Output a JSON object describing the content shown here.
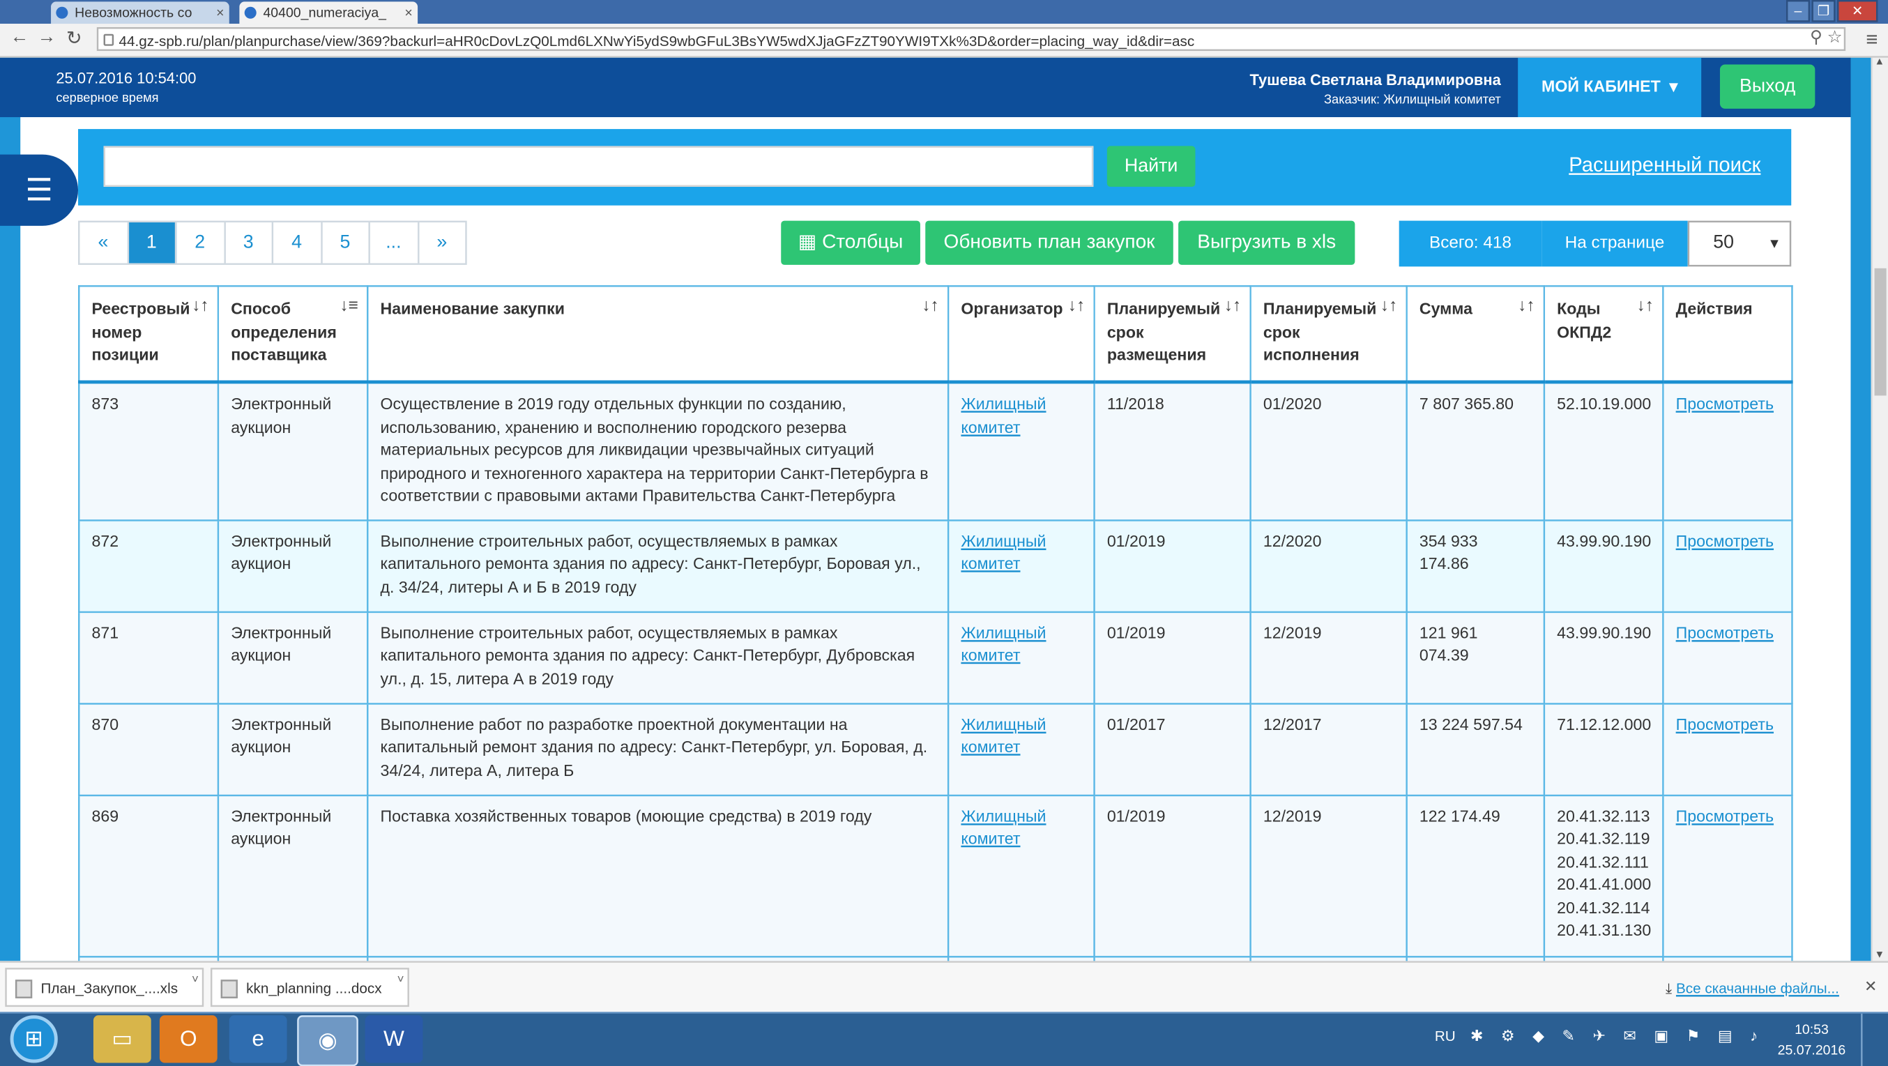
{
  "browser": {
    "tabs": [
      "Невозможность со",
      "40400_numeraciya_"
    ],
    "url": "44.gz-spb.ru/plan/planpurchase/view/369?backurl=aHR0cDovLzQ0Lmd6LXNwYi5ydS9wbGFuL3BsYW5wdXJjaGFzZT90YWI9TXk%3D&order=placing_way_id&dir=asc"
  },
  "header": {
    "server_time": "25.07.2016 10:54:00",
    "server_time_label": "серверное время",
    "user_name": "Тушева Светлана Владимировна",
    "user_role": "Заказчик: Жилищный комитет",
    "cabinet_label": "МОЙ КАБИНЕТ",
    "logout_label": "Выход",
    "brand_color": "#0d4e9a",
    "accent_color": "#2ec574"
  },
  "search": {
    "query": "",
    "button_label": "Найти",
    "advanced_label": "Расширенный поиск"
  },
  "pager": {
    "prev": "«",
    "pages": [
      "1",
      "2",
      "3",
      "4",
      "5",
      "..."
    ],
    "next": "»",
    "current": "1"
  },
  "toolbar": {
    "columns_label": "Столбцы",
    "refresh_label": "Обновить план закупок",
    "export_label": "Выгрузить в xls",
    "total_label": "Всего: 418",
    "per_page_label": "На странице",
    "per_page_value": "50"
  },
  "table": {
    "headers": [
      "Реестровый номер позиции",
      "Способ определения поставщика",
      "Наименование закупки",
      "Организатор",
      "Планируемый срок размещения",
      "Планируемый срок исполнения",
      "Сумма",
      "Коды ОКПД2",
      "Действия"
    ],
    "rows": [
      {
        "num": "873",
        "method": "Электронный аукцион",
        "name": "Осуществление в 2019 году отдельных функции по созданию, использованию, хранению и восполнению городского резерва материальных ресурсов для ликвидации чрезвычайных ситуаций природного и техногенного характера на территории Санкт-Петербурга в соответствии с правовыми актами Правительства Санкт-Петербурга",
        "organizer": "Жилищный комитет",
        "placement": "11/2018",
        "execution": "01/2020",
        "sum": "7 807 365.80",
        "codes": "52.10.19.000",
        "action": "Просмотреть"
      },
      {
        "num": "872",
        "method": "Электронный аукцион",
        "name": "Выполнение строительных работ, осуществляемых в рамках капитального ремонта здания по адресу: Санкт-Петербург, Боровая ул., д. 34/24, литеры А и Б в 2019 году",
        "organizer": "Жилищный комитет",
        "placement": "01/2019",
        "execution": "12/2020",
        "sum": "354 933 174.86",
        "codes": "43.99.90.190",
        "action": "Просмотреть"
      },
      {
        "num": "871",
        "method": "Электронный аукцион",
        "name": "Выполнение строительных работ, осуществляемых в рамках капитального ремонта здания по адресу: Санкт-Петербург, Дубровская ул., д. 15, литера А в 2019 году",
        "organizer": "Жилищный комитет",
        "placement": "01/2019",
        "execution": "12/2019",
        "sum": "121 961 074.39",
        "codes": "43.99.90.190",
        "action": "Просмотреть"
      },
      {
        "num": "870",
        "method": "Электронный аукцион",
        "name": "Выполнение работ по разработке проектной документации на капитальный ремонт здания по адресу: Санкт-Петербург, ул. Боровая, д. 34/24, литера А, литера Б",
        "organizer": "Жилищный комитет",
        "placement": "01/2017",
        "execution": "12/2017",
        "sum": "13 224 597.54",
        "codes": "71.12.12.000",
        "action": "Просмотреть"
      },
      {
        "num": "869",
        "method": "Электронный аукцион",
        "name": "Поставка хозяйственных товаров (моющие средства) в 2019 году",
        "organizer": "Жилищный комитет",
        "placement": "01/2019",
        "execution": "12/2019",
        "sum": "122 174.49",
        "codes": "20.41.32.113\n20.41.32.119\n20.41.32.111\n20.41.41.000\n20.41.32.114\n20.41.31.130",
        "action": "Просмотреть"
      }
    ]
  },
  "downloads": {
    "items": [
      "План_Закупок_....xls",
      "kkn_planning ....docx"
    ],
    "all_label": "Все скачанные файлы..."
  },
  "taskbar": {
    "lang": "RU",
    "time": "10:53",
    "date": "25.07.2016"
  }
}
